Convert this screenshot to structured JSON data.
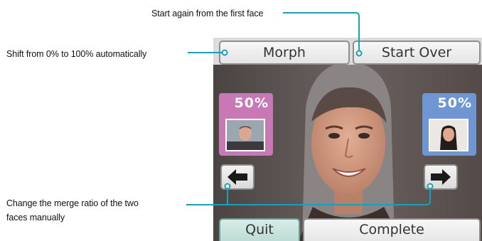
{
  "callouts": {
    "start_over": "Start again from the first face",
    "morph": "Shift from 0% to 100% automatically",
    "manual_line1": "Change the merge ratio of the two",
    "manual_line2": "faces manually"
  },
  "toolbar": {
    "morph_label": "Morph",
    "start_over_label": "Start Over"
  },
  "left_face": {
    "percent": "50%",
    "color": "#c878b4"
  },
  "right_face": {
    "percent": "50%",
    "color": "#6e96d2"
  },
  "footer": {
    "quit_label": "Quit",
    "complete_label": "Complete"
  },
  "colors": {
    "callout_line": "#19a0b4"
  }
}
